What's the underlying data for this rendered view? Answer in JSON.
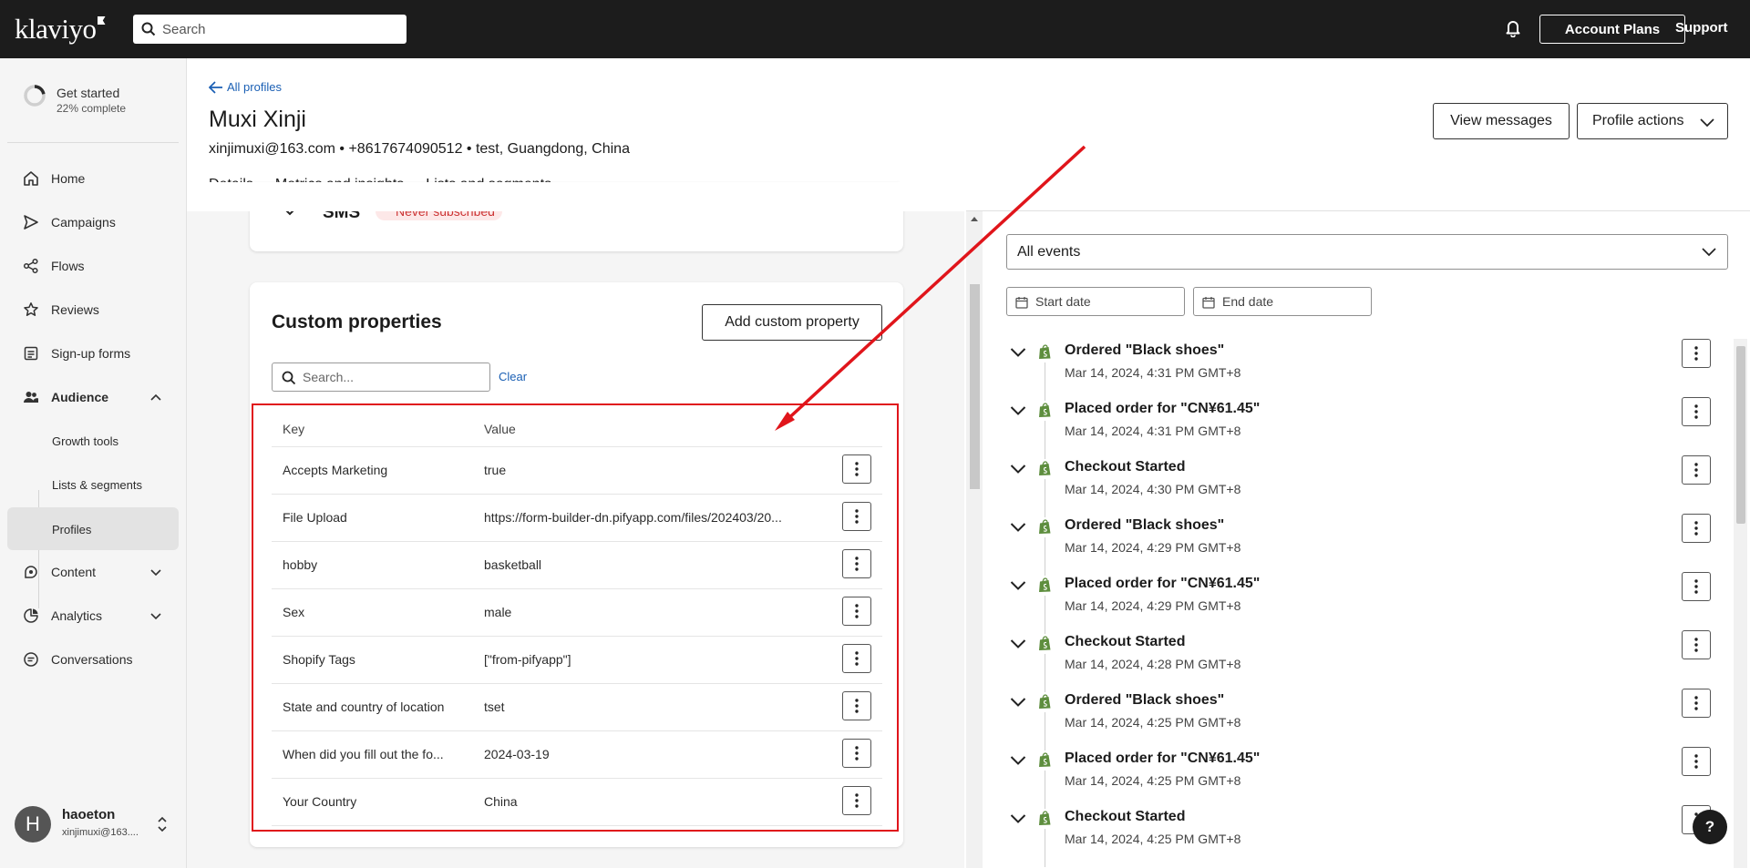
{
  "topbar": {
    "logo": "klaviyo",
    "search_placeholder": "Search",
    "account_plans": "Account Plans",
    "support": "Support"
  },
  "sidebar": {
    "get_started": {
      "title": "Get started",
      "progress": "22% complete",
      "percent": 22
    },
    "items": [
      {
        "label": "Home",
        "icon": "home-icon"
      },
      {
        "label": "Campaigns",
        "icon": "send-icon"
      },
      {
        "label": "Flows",
        "icon": "flows-icon"
      },
      {
        "label": "Reviews",
        "icon": "star-icon"
      },
      {
        "label": "Sign-up forms",
        "icon": "form-icon"
      },
      {
        "label": "Audience",
        "icon": "people-icon"
      },
      {
        "label": "Content",
        "icon": "content-icon"
      },
      {
        "label": "Analytics",
        "icon": "analytics-icon"
      },
      {
        "label": "Conversations",
        "icon": "chat-icon"
      }
    ],
    "audience_sub": [
      {
        "label": "Growth tools"
      },
      {
        "label": "Lists & segments"
      },
      {
        "label": "Profiles"
      }
    ],
    "user": {
      "initial": "H",
      "name": "haoeton",
      "email": "xinjimuxi@163...."
    }
  },
  "header": {
    "back_label": "All profiles",
    "name": "Muxi Xinji",
    "meta": "xinjimuxi@163.com • +8617674090512 • test, Guangdong, China",
    "view_messages": "View messages",
    "profile_actions": "Profile actions",
    "tabs": [
      "Details",
      "Metrics and insights",
      "Lists and segments"
    ]
  },
  "sms_card": {
    "label": "SMS",
    "status": "Never subscribed"
  },
  "custom_properties": {
    "title": "Custom properties",
    "add_button": "Add custom property",
    "search_placeholder": "Search...",
    "clear": "Clear",
    "columns": [
      "Key",
      "Value"
    ],
    "rows": [
      {
        "key": "Accepts Marketing",
        "value": "true"
      },
      {
        "key": "File Upload",
        "value": "https://form-builder-dn.pifyapp.com/files/202403/20..."
      },
      {
        "key": "hobby",
        "value": "basketball"
      },
      {
        "key": "Sex",
        "value": "male"
      },
      {
        "key": "Shopify Tags",
        "value": "[\"from-pifyapp\"]"
      },
      {
        "key": "State and country of location",
        "value": "tset"
      },
      {
        "key": "When did you fill out the fo...",
        "value": "2024-03-19"
      },
      {
        "key": "Your Country",
        "value": "China"
      }
    ]
  },
  "events": {
    "filter": "All events",
    "start_date": "Start date",
    "end_date": "End date",
    "items": [
      {
        "title": "Ordered \"Black shoes\"",
        "date": "Mar 14, 2024, 4:31 PM GMT+8"
      },
      {
        "title": "Placed order for \"CN¥61.45\"",
        "date": "Mar 14, 2024, 4:31 PM GMT+8"
      },
      {
        "title": "Checkout Started",
        "date": "Mar 14, 2024, 4:30 PM GMT+8"
      },
      {
        "title": "Ordered \"Black shoes\"",
        "date": "Mar 14, 2024, 4:29 PM GMT+8"
      },
      {
        "title": "Placed order for \"CN¥61.45\"",
        "date": "Mar 14, 2024, 4:29 PM GMT+8"
      },
      {
        "title": "Checkout Started",
        "date": "Mar 14, 2024, 4:28 PM GMT+8"
      },
      {
        "title": "Ordered \"Black shoes\"",
        "date": "Mar 14, 2024, 4:25 PM GMT+8"
      },
      {
        "title": "Placed order for \"CN¥61.45\"",
        "date": "Mar 14, 2024, 4:25 PM GMT+8"
      },
      {
        "title": "Checkout Started",
        "date": "Mar 14, 2024, 4:25 PM GMT+8"
      }
    ]
  },
  "help_label": "?",
  "colors": {
    "topbar": "#1c1c1c",
    "link": "#1a5fb4",
    "annotation": "#e0151b",
    "shopify": "#5e8e3e"
  }
}
